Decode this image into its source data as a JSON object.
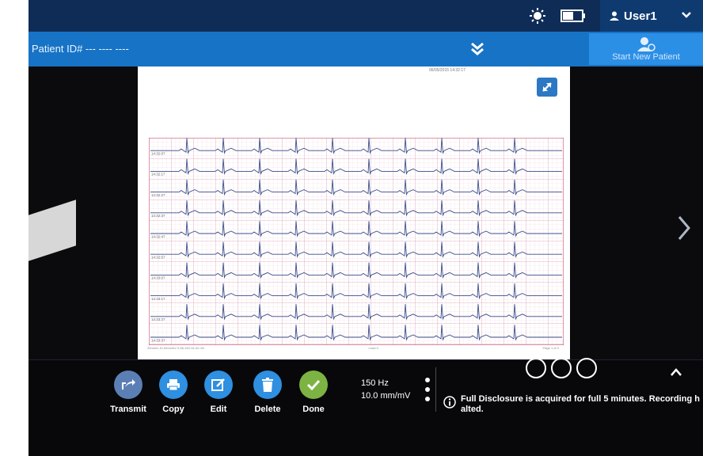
{
  "statusbar": {
    "brightness_icon": "brightness-icon",
    "battery_icon": "battery-icon",
    "user_name": "User1"
  },
  "patientbar": {
    "patient_label": "Patient ID# ---  ----  ----",
    "start_new_patient": "Start New Patient"
  },
  "document": {
    "timestamp": "06/05/2015 14:32:17",
    "rhythm_rows": [
      "14:32:07",
      "14:32:17",
      "14:32:27",
      "14:32:37",
      "14:32:47",
      "14:32:57",
      "14:33:07",
      "14:33:17",
      "14:33:27",
      "14:33:37"
    ],
    "footer_left": "25mm/s  10.0mm/mV  0.56-150 Hz  AC 60",
    "footer_mid": "Lead II",
    "footer_right": "Page 1 of 3"
  },
  "toolbar": {
    "actions": [
      {
        "label": "Transmit",
        "icon": "share-icon",
        "color": "#5b7fb5"
      },
      {
        "label": "Copy",
        "icon": "printer-icon",
        "color": "#2f8fe0"
      },
      {
        "label": "Edit",
        "icon": "edit-icon",
        "color": "#2f8fe0"
      },
      {
        "label": "Delete",
        "icon": "trash-icon",
        "color": "#2f8fe0"
      },
      {
        "label": "Done",
        "icon": "check-icon",
        "color": "#7cb342"
      }
    ],
    "filter": "150 Hz",
    "gain": "10.0 mm/mV",
    "info_message": "Full Disclosure is acquired for full 5 minutes. Recording halted."
  },
  "colors": {
    "statusbar": "#0f2c57",
    "patientbar": "#1773c6",
    "grid": "#d9a3b4",
    "trace": "#3c4f8c"
  }
}
